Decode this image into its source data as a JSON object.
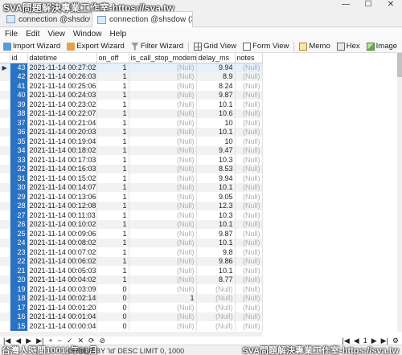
{
  "watermark": "SVA問題解決專業工作室-https://sva.tw",
  "tabs": [
    {
      "label": "connection @shsdow (3..."
    },
    {
      "label": "connection @shsdow (3..."
    }
  ],
  "window_controls": {
    "minimize": "—",
    "maximize": "☐",
    "close": "✕"
  },
  "menu": [
    "File",
    "Edit",
    "View",
    "Window",
    "Help"
  ],
  "toolbar": {
    "import": "Import Wizard",
    "export": "Export Wizard",
    "filter": "Filter Wizard",
    "grid": "Grid View",
    "form": "Form View",
    "memo": "Memo",
    "hex": "Hex",
    "image": "Image"
  },
  "columns": [
    "id",
    "datetime",
    "on_off",
    "is_call_stop_modem",
    "delay_ms",
    "notes"
  ],
  "rows": [
    {
      "id": "43",
      "datetime": "2021-11-14 00:27:02",
      "on_off": "1",
      "is_call": "(Null)",
      "delay": "9.94",
      "notes": "(Null)"
    },
    {
      "id": "42",
      "datetime": "2021-11-14 00:26:03",
      "on_off": "1",
      "is_call": "(Null)",
      "delay": "8.9",
      "notes": "(Null)"
    },
    {
      "id": "41",
      "datetime": "2021-11-14 00:25:06",
      "on_off": "1",
      "is_call": "(Null)",
      "delay": "8.24",
      "notes": "(Null)"
    },
    {
      "id": "40",
      "datetime": "2021-11-14 00:24:03",
      "on_off": "1",
      "is_call": "(Null)",
      "delay": "9.87",
      "notes": "(Null)"
    },
    {
      "id": "39",
      "datetime": "2021-11-14 00:23:02",
      "on_off": "1",
      "is_call": "(Null)",
      "delay": "10.1",
      "notes": "(Null)"
    },
    {
      "id": "38",
      "datetime": "2021-11-14 00:22:07",
      "on_off": "1",
      "is_call": "(Null)",
      "delay": "10.6",
      "notes": "(Null)"
    },
    {
      "id": "37",
      "datetime": "2021-11-14 00:21:04",
      "on_off": "1",
      "is_call": "(Null)",
      "delay": "10",
      "notes": "(Null)"
    },
    {
      "id": "36",
      "datetime": "2021-11-14 00:20:03",
      "on_off": "1",
      "is_call": "(Null)",
      "delay": "10.1",
      "notes": "(Null)"
    },
    {
      "id": "35",
      "datetime": "2021-11-14 00:19:04",
      "on_off": "1",
      "is_call": "(Null)",
      "delay": "10",
      "notes": "(Null)"
    },
    {
      "id": "34",
      "datetime": "2021-11-14 00:18:02",
      "on_off": "1",
      "is_call": "(Null)",
      "delay": "9.47",
      "notes": "(Null)"
    },
    {
      "id": "33",
      "datetime": "2021-11-14 00:17:03",
      "on_off": "1",
      "is_call": "(Null)",
      "delay": "10.3",
      "notes": "(Null)"
    },
    {
      "id": "32",
      "datetime": "2021-11-14 00:16:03",
      "on_off": "1",
      "is_call": "(Null)",
      "delay": "8.53",
      "notes": "(Null)"
    },
    {
      "id": "31",
      "datetime": "2021-11-14 00:15:02",
      "on_off": "1",
      "is_call": "(Null)",
      "delay": "9.94",
      "notes": "(Null)"
    },
    {
      "id": "30",
      "datetime": "2021-11-14 00:14:07",
      "on_off": "1",
      "is_call": "(Null)",
      "delay": "10.1",
      "notes": "(Null)"
    },
    {
      "id": "29",
      "datetime": "2021-11-14 00:13:06",
      "on_off": "1",
      "is_call": "(Null)",
      "delay": "9.05",
      "notes": "(Null)"
    },
    {
      "id": "28",
      "datetime": "2021-11-14 00:12:08",
      "on_off": "1",
      "is_call": "(Null)",
      "delay": "12.3",
      "notes": "(Null)"
    },
    {
      "id": "27",
      "datetime": "2021-11-14 00:11:03",
      "on_off": "1",
      "is_call": "(Null)",
      "delay": "10.3",
      "notes": "(Null)"
    },
    {
      "id": "26",
      "datetime": "2021-11-14 00:10:02",
      "on_off": "1",
      "is_call": "(Null)",
      "delay": "10.1",
      "notes": "(Null)"
    },
    {
      "id": "25",
      "datetime": "2021-11-14 00:09:06",
      "on_off": "1",
      "is_call": "(Null)",
      "delay": "9.87",
      "notes": "(Null)"
    },
    {
      "id": "24",
      "datetime": "2021-11-14 00:08:02",
      "on_off": "1",
      "is_call": "(Null)",
      "delay": "10.1",
      "notes": "(Null)"
    },
    {
      "id": "23",
      "datetime": "2021-11-14 00:07:02",
      "on_off": "1",
      "is_call": "(Null)",
      "delay": "9.8",
      "notes": "(Null)"
    },
    {
      "id": "22",
      "datetime": "2021-11-14 00:06:02",
      "on_off": "1",
      "is_call": "(Null)",
      "delay": "9.86",
      "notes": "(Null)"
    },
    {
      "id": "21",
      "datetime": "2021-11-14 00:05:03",
      "on_off": "1",
      "is_call": "(Null)",
      "delay": "10.1",
      "notes": "(Null)"
    },
    {
      "id": "20",
      "datetime": "2021-11-14 00:04:02",
      "on_off": "1",
      "is_call": "(Null)",
      "delay": "8.77",
      "notes": "(Null)"
    },
    {
      "id": "19",
      "datetime": "2021-11-14 00:03:09",
      "on_off": "0",
      "is_call": "(Null)",
      "delay": "(Null)",
      "notes": "(Null)"
    },
    {
      "id": "18",
      "datetime": "2021-11-14 00:02:14",
      "on_off": "0",
      "is_call": "1",
      "delay": "(Null)",
      "notes": "(Null)"
    },
    {
      "id": "17",
      "datetime": "2021-11-14 00:01:20",
      "on_off": "0",
      "is_call": "(Null)",
      "delay": "(Null)",
      "notes": "(Null)"
    },
    {
      "id": "16",
      "datetime": "2021-11-14 00:01:04",
      "on_off": "0",
      "is_call": "(Null)",
      "delay": "(Null)",
      "notes": "(Null)"
    },
    {
      "id": "15",
      "datetime": "2021-11-14 00:00:04",
      "on_off": "0",
      "is_call": "(Null)",
      "delay": "(Null)",
      "notes": "(Null)"
    }
  ],
  "selected_row_indicator": "▶",
  "nav": {
    "first": "|◀",
    "prev": "◀",
    "next": "▶",
    "last": "▶|",
    "add": "+",
    "delete": "−",
    "confirm": "✓",
    "cancel": "✕",
    "refresh": "⟳",
    "stop": "⊘"
  },
  "pager": {
    "first": "|◀",
    "prev": "◀",
    "page": "1",
    "next": "▶",
    "last": "▶|",
    "settings": "⚙"
  },
  "status": {
    "left_watermark": "台灣人時間10011年01月",
    "sql": "ORDER BY 'id' DESC LIMIT 0, 1000",
    "right_watermark": "SVA問題解決專業工作室-https://sva.tw"
  }
}
